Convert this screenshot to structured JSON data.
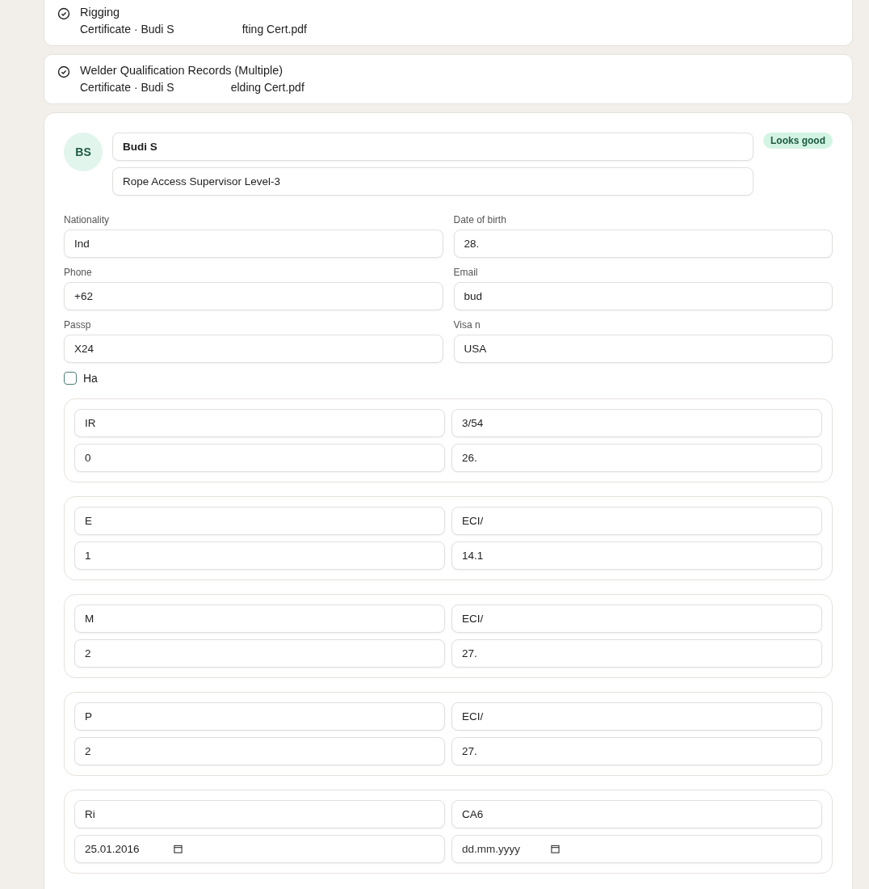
{
  "documents": [
    {
      "title": "Rigging",
      "meta": "Certificate · Budi S",
      "file_tail": "fting Cert.pdf"
    },
    {
      "title": "Welder Qualification Records (Multiple)",
      "meta": "Certificate · Budi S",
      "file_tail": "elding Cert.pdf"
    }
  ],
  "profile": {
    "initials": "BS",
    "name": "Budi S",
    "role": "Rope Access Supervisor Level-3",
    "badge": "Looks good"
  },
  "fields": [
    {
      "label": "Nationality",
      "value": "Ind"
    },
    {
      "label": "Date of birth",
      "value": "28."
    },
    {
      "label": "Phone",
      "value": "+62"
    },
    {
      "label": "Email",
      "value": "bud"
    },
    {
      "label": "Passp",
      "value": "X24"
    },
    {
      "label": "Visa n",
      "value": "USA"
    }
  ],
  "checkbox": {
    "label": "Ha",
    "checked": false
  },
  "groups": [
    [
      {
        "kind": "text",
        "value": "IR"
      },
      {
        "kind": "text",
        "value": "3/54"
      },
      {
        "kind": "text",
        "value": "0"
      },
      {
        "kind": "text",
        "value": "26."
      }
    ],
    [
      {
        "kind": "text",
        "value": "E"
      },
      {
        "kind": "text",
        "value": "ECI/"
      },
      {
        "kind": "text",
        "value": "1"
      },
      {
        "kind": "text",
        "value": "14.1"
      }
    ],
    [
      {
        "kind": "text",
        "value": "M"
      },
      {
        "kind": "text",
        "value": "ECI/"
      },
      {
        "kind": "text",
        "value": "2"
      },
      {
        "kind": "text",
        "value": "27."
      }
    ],
    [
      {
        "kind": "text",
        "value": "P"
      },
      {
        "kind": "text",
        "value": "ECI/"
      },
      {
        "kind": "text",
        "value": "2"
      },
      {
        "kind": "text",
        "value": "27."
      }
    ],
    [
      {
        "kind": "text",
        "value": "Ri"
      },
      {
        "kind": "text",
        "value": "CA6"
      },
      {
        "kind": "date",
        "value": "25.01.2016"
      },
      {
        "kind": "date",
        "placeholder": "dd.mm.yyyy"
      }
    ]
  ]
}
